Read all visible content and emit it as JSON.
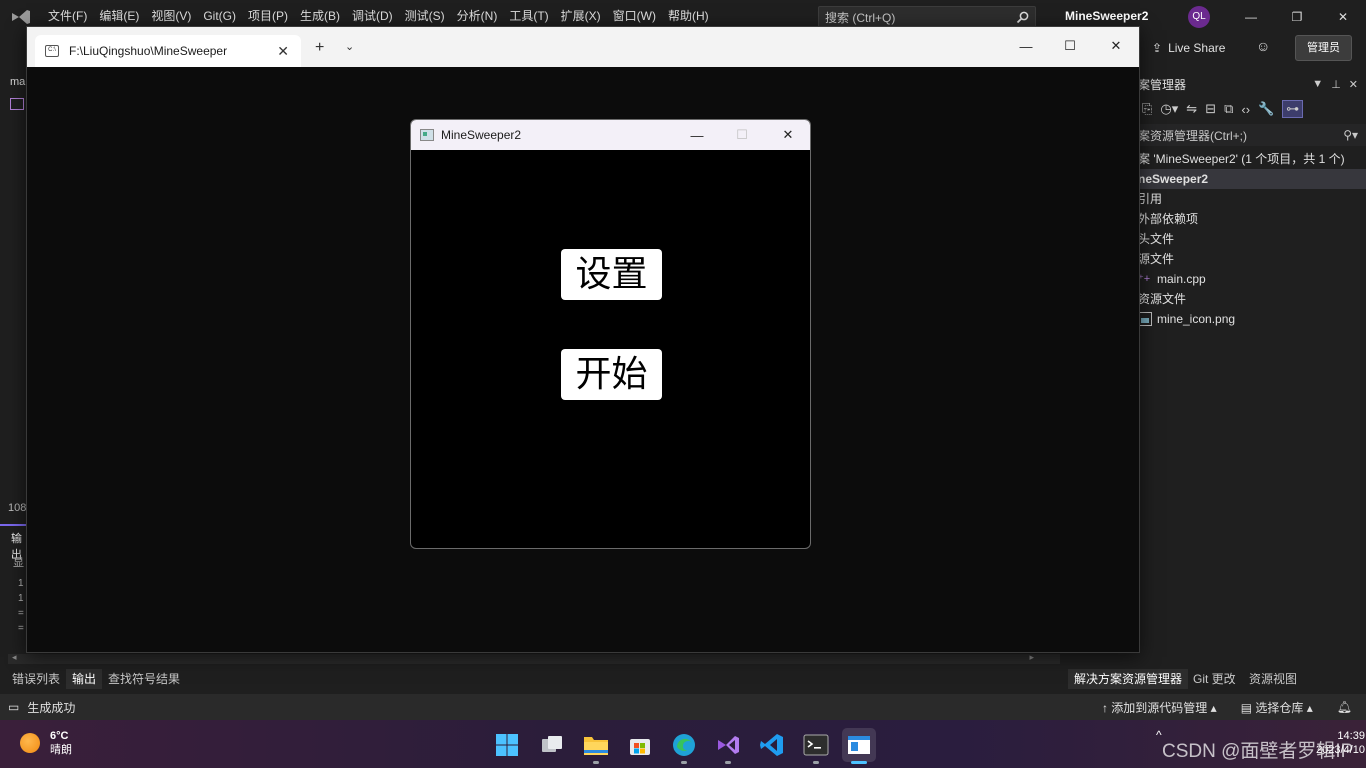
{
  "vs": {
    "menu": [
      "文件(F)",
      "编辑(E)",
      "视图(V)",
      "Git(G)",
      "项目(P)",
      "生成(B)",
      "调试(D)",
      "测试(S)",
      "分析(N)",
      "工具(T)",
      "扩展(X)",
      "窗口(W)",
      "帮助(H)"
    ],
    "search_placeholder": "搜索 (Ctrl+Q)",
    "title": "MineSweeper2",
    "avatar": "QL",
    "live_share": "Live Share",
    "admin": "管理员"
  },
  "solution_explorer": {
    "header": "案管理器",
    "search_placeholder": "案资源管理器(Ctrl+;)",
    "tree": [
      {
        "label": "案 'MineSweeper2' (1 个项目，共 1 个)",
        "selected": false,
        "icon": ""
      },
      {
        "label": "neSweeper2",
        "selected": true,
        "icon": ""
      },
      {
        "label": "引用",
        "selected": false,
        "icon": ""
      },
      {
        "label": "外部依赖项",
        "selected": false,
        "icon": ""
      },
      {
        "label": "头文件",
        "selected": false,
        "icon": ""
      },
      {
        "label": "源文件",
        "selected": false,
        "icon": ""
      },
      {
        "label": "main.cpp",
        "selected": false,
        "icon": "cpp"
      },
      {
        "label": "资源文件",
        "selected": false,
        "icon": ""
      },
      {
        "label": "mine_icon.png",
        "selected": false,
        "icon": "png"
      }
    ]
  },
  "left_strip": {
    "top_label": "ma",
    "line_no": "108",
    "output_label": "输出",
    "show_label": "显",
    "lines": [
      "1",
      "1",
      "=",
      "="
    ]
  },
  "bottom_tabs": {
    "left": [
      "错误列表",
      "输出",
      "查找符号结果"
    ],
    "right": [
      "解决方案资源管理器",
      "Git 更改",
      "资源视图"
    ]
  },
  "statusbar": {
    "status": "生成成功",
    "add_source": "添加到源代码管理",
    "select_repo": "选择仓库"
  },
  "terminal": {
    "tab_title": "F:\\LiuQingshuo\\MineSweeper"
  },
  "game": {
    "title": "MineSweeper2",
    "settings_button": "设置",
    "start_button": "开始"
  },
  "taskbar": {
    "weather_temp": "6°C",
    "weather_desc": "晴朗",
    "time": "14:39",
    "date": "2023/4/10",
    "watermark": "CSDN @面壁者罗辑IP"
  }
}
